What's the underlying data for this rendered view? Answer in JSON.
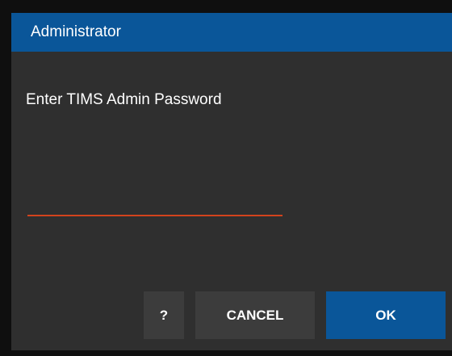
{
  "dialog": {
    "title": "Administrator",
    "prompt": "Enter TIMS Admin Password",
    "password": {
      "value": "",
      "placeholder": ""
    },
    "buttons": {
      "help_label": "?",
      "cancel_label": "CANCEL",
      "ok_label": "OK"
    },
    "colors": {
      "title_bar": "#0a5699",
      "dialog_background": "#2f2f2f",
      "input_underline": "#d2431d",
      "secondary_button": "#3c3c3c",
      "primary_button": "#0a5699"
    }
  }
}
